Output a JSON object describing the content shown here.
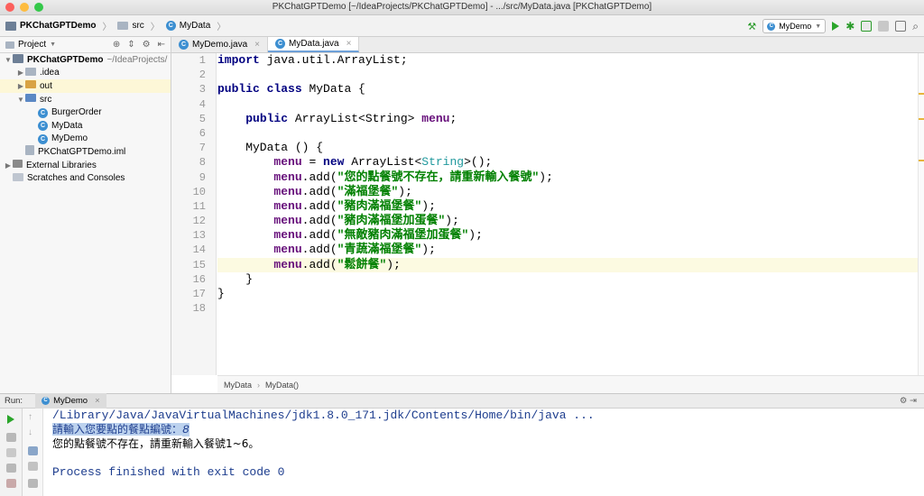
{
  "window": {
    "title": "PKChatGPTDemo [~/IdeaProjects/PKChatGPTDemo] - .../src/MyData.java [PKChatGPTDemo]"
  },
  "breadcrumb": {
    "project": "PKChatGPTDemo",
    "folder": "src",
    "file": "MyData"
  },
  "toolbar": {
    "run_config": "MyDemo"
  },
  "project_panel": {
    "title": "Project",
    "tree": [
      {
        "label": "PKChatGPTDemo",
        "path": "~/IdeaProjects/",
        "depth": 0,
        "icon": "project-folder-icon",
        "expanded": true
      },
      {
        "label": ".idea",
        "depth": 1,
        "icon": "folder-icon",
        "expanded": false
      },
      {
        "label": "out",
        "depth": 1,
        "icon": "folder-excluded-icon",
        "expanded": false,
        "selected": true
      },
      {
        "label": "src",
        "depth": 1,
        "icon": "source-folder-icon",
        "expanded": true
      },
      {
        "label": "BurgerOrder",
        "depth": 2,
        "icon": "java-class-icon"
      },
      {
        "label": "MyData",
        "depth": 2,
        "icon": "java-class-icon"
      },
      {
        "label": "MyDemo",
        "depth": 2,
        "icon": "java-class-icon"
      },
      {
        "label": "PKChatGPTDemo.iml",
        "depth": 1,
        "icon": "iml-file-icon"
      },
      {
        "label": "External Libraries",
        "depth": 0,
        "icon": "libraries-icon",
        "expanded": false
      },
      {
        "label": "Scratches and Consoles",
        "depth": 0,
        "icon": "scratches-icon"
      }
    ]
  },
  "editor": {
    "tabs": [
      {
        "label": "MyDemo.java",
        "active": false
      },
      {
        "label": "MyData.java",
        "active": true
      }
    ],
    "line_numbers": [
      "1",
      "2",
      "3",
      "4",
      "5",
      "6",
      "7",
      "8",
      "9",
      "10",
      "11",
      "12",
      "13",
      "14",
      "15",
      "16",
      "17",
      "18"
    ],
    "lines": {
      "l1_kw": "import",
      "l1_rest": " java.util.ArrayList;",
      "l3_kw1": "public",
      "l3_kw2": "class",
      "l3_name": " MyData {",
      "l5_kw": "public",
      "l5_type": " ArrayList<String> ",
      "l5_field": "menu",
      "l5_end": ";",
      "l7": "    MyData () {",
      "l8_field": "menu",
      "l8_mid": " = ",
      "l8_kw": "new",
      "l8_type1": " ArrayList<",
      "l8_gen": "String",
      "l8_type2": ">();",
      "add_call": ".add(",
      "add_end": ");",
      "s9": "\"您的點餐號不存在，請重新輸入餐號\"",
      "s10": "\"滿福堡餐\"",
      "s11": "\"豬肉滿福堡餐\"",
      "s12": "\"豬肉滿福堡加蛋餐\"",
      "s13": "\"無敵豬肉滿福堡加蛋餐\"",
      "s14": "\"青蔬滿福堡餐\"",
      "s15": "\"鬆餅餐\"",
      "l16": "    }",
      "l17": "}"
    },
    "breadcrumb": [
      "MyData",
      "MyData()"
    ]
  },
  "run_panel": {
    "label": "Run:",
    "tab": "MyDemo",
    "console": {
      "cmd": "/Library/Java/JavaVirtualMachines/jdk1.8.0_171.jdk/Contents/Home/bin/java ...",
      "prompt": "請輸入您要點的餐點編號：",
      "input": "8",
      "output": "您的點餐號不存在，請重新輸入餐號1~6。",
      "finish": "Process finished with exit code 0"
    }
  }
}
